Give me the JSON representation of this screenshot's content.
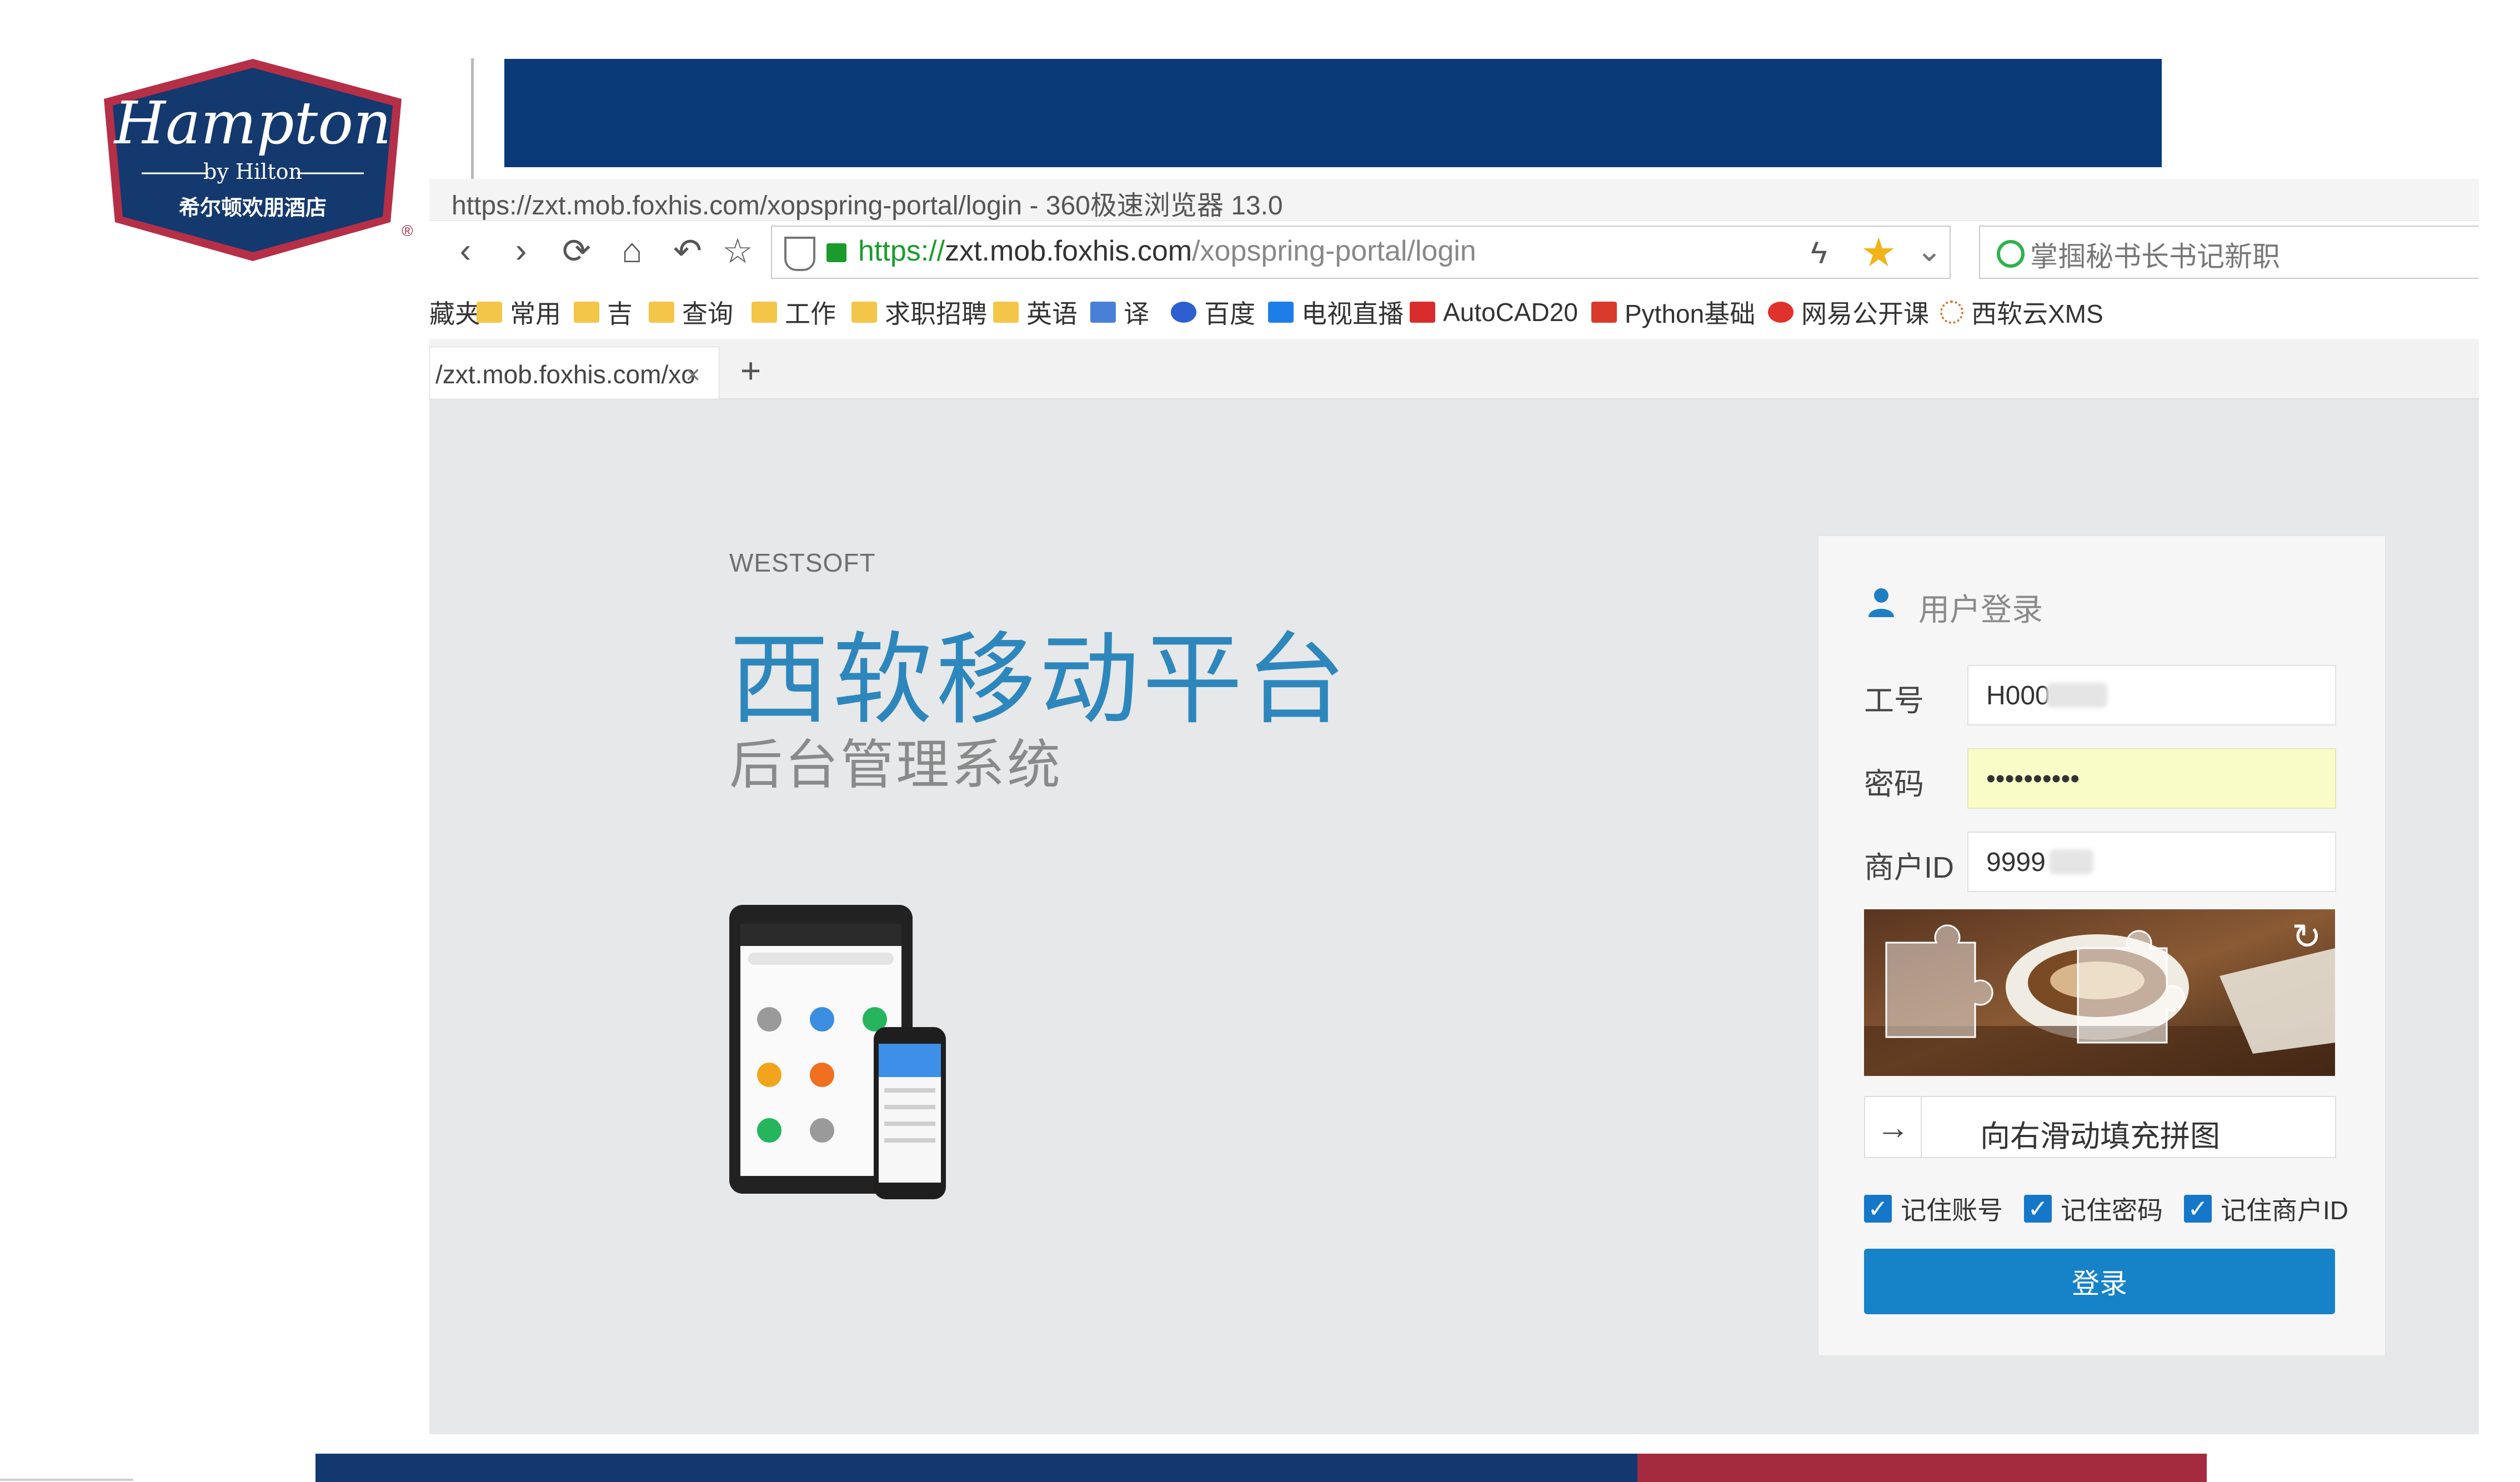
{
  "logo": {
    "brand": "Hampton",
    "byline": "by Hilton",
    "chinese_name": "希尔顿欢朋酒店",
    "mark": "®"
  },
  "browser": {
    "title": "https://zxt.mob.foxhis.com/xopspring-portal/login - 360极速浏览器 13.0",
    "url_scheme": "https://",
    "url_host": "zxt.mob.foxhis.com",
    "url_path": "/xopspring-portal/login",
    "search_placeholder": "掌掴秘书长书记新职",
    "bookmarks": [
      {
        "label": "藏夹",
        "icon": "folder-icon"
      },
      {
        "label": "常用",
        "icon": "folder-icon"
      },
      {
        "label": "吉",
        "icon": "folder-icon"
      },
      {
        "label": "查询",
        "icon": "folder-icon"
      },
      {
        "label": "工作",
        "icon": "folder-icon"
      },
      {
        "label": "求职招聘",
        "icon": "folder-icon"
      },
      {
        "label": "英语",
        "icon": "folder-icon"
      },
      {
        "label": "译",
        "icon": "translate-icon"
      },
      {
        "label": "百度",
        "icon": "baidu-paw-icon"
      },
      {
        "label": "电视直播",
        "icon": "tv-icon"
      },
      {
        "label": "AutoCAD20",
        "icon": "autocad-icon"
      },
      {
        "label": "Python基础",
        "icon": "c-logo-icon"
      },
      {
        "label": "网易公开课",
        "icon": "netease-icon"
      },
      {
        "label": "西软云XMS",
        "icon": "loading-dots-icon"
      }
    ],
    "tab_label": "/zxt.mob.foxhis.com/xo",
    "tab_close": "×",
    "new_tab": "+"
  },
  "page": {
    "brand_small": "WESTSOFT",
    "title": "西软移动平台",
    "subtitle": "后台管理系统"
  },
  "login": {
    "heading": "用户登录",
    "employee_label": "工号",
    "employee_value": "H000",
    "password_label": "密码",
    "password_value": "••••••••••",
    "merchant_label": "商户ID",
    "merchant_value": "9999",
    "slider_text": "向右滑动填充拼图",
    "slider_arrow": "→",
    "remember_account": "记住账号",
    "remember_password": "记住密码",
    "remember_merchant": "记住商户ID",
    "submit": "登录",
    "checks": [
      true,
      true,
      true
    ]
  },
  "colors": {
    "banner_blue": "#0b3a78",
    "bottom_red": "#a42a3e",
    "accent": "#1682c8",
    "title_blue": "#2d87bd"
  }
}
